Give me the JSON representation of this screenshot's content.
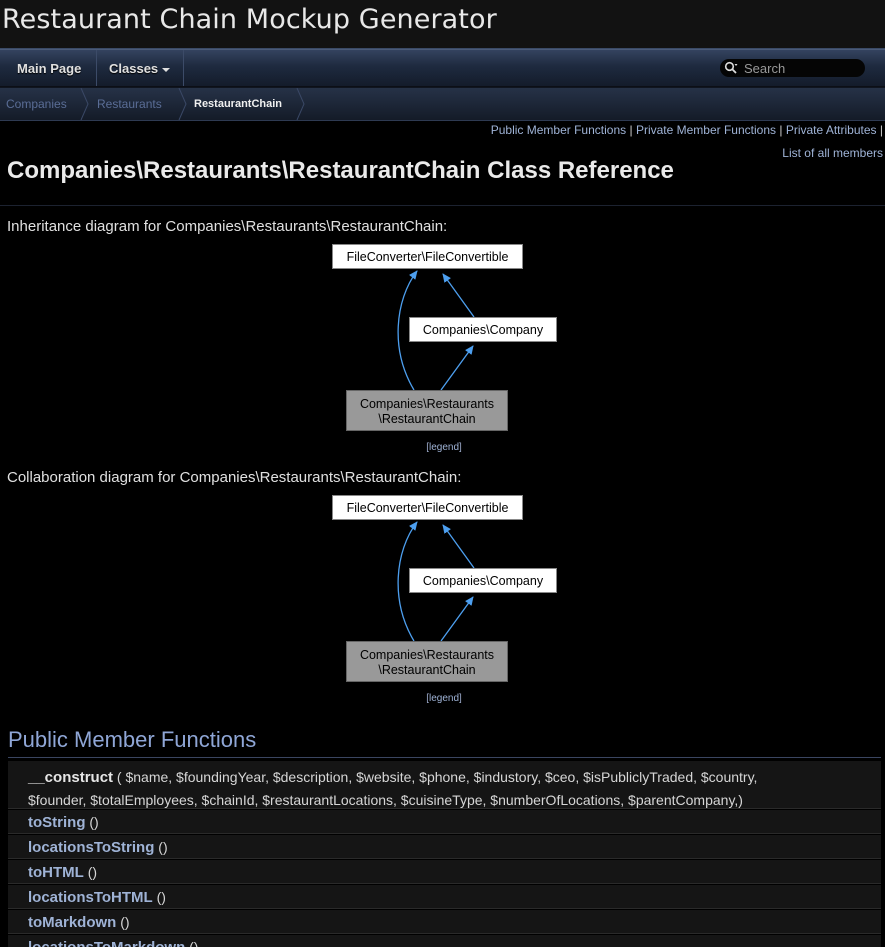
{
  "project": {
    "name": "Restaurant Chain Mockup Generator"
  },
  "navbar": {
    "main_page": "Main Page",
    "classes": "Classes",
    "search_placeholder": "Search"
  },
  "breadcrumb": [
    "Companies",
    "Restaurants",
    "RestaurantChain"
  ],
  "summary_links": {
    "public_member_functions": "Public Member Functions",
    "private_member_functions": "Private Member Functions",
    "private_attributes": "Private Attributes",
    "list_all_members": "List of all members",
    "separator": "|"
  },
  "header": {
    "title": "Companies\\Restaurants\\RestaurantChain Class Reference"
  },
  "diagrams": {
    "inheritance_caption": "Inheritance diagram for Companies\\Restaurants\\RestaurantChain:",
    "collaboration_caption": "Collaboration diagram for Companies\\Restaurants\\RestaurantChain:",
    "node_interface": "FileConverter\\FileConvertible",
    "node_company": "Companies\\Company",
    "node_chain_line1": "Companies\\Restaurants",
    "node_chain_line2": "\\RestaurantChain",
    "legend_open": "[",
    "legend_label": "legend",
    "legend_close": "]"
  },
  "public_member_functions": {
    "heading": "Public Member Functions",
    "constructor": {
      "name": "__construct",
      "params_line1": "( $name, $foundingYear, $description, $website, $phone, $industory, $ceo, $isPubliclyTraded, $country,",
      "params_line2": "$founder, $totalEmployees, $chainId, $restaurantLocations, $cuisineType, $numberOfLocations, $parentCompany,)"
    },
    "functions": [
      {
        "name": "toString",
        "params": "()"
      },
      {
        "name": "locationsToString",
        "params": "()"
      },
      {
        "name": "toHTML",
        "params": "()"
      },
      {
        "name": "locationsToHTML",
        "params": "()"
      },
      {
        "name": "toMarkdown",
        "params": "()"
      },
      {
        "name": "locationsToMarkdown",
        "params": "()"
      }
    ]
  },
  "colors": {
    "link": "#9fb3d6",
    "heading": "#8fa6d6",
    "arrow": "#4d9fef",
    "node_highlight": "#999999"
  }
}
